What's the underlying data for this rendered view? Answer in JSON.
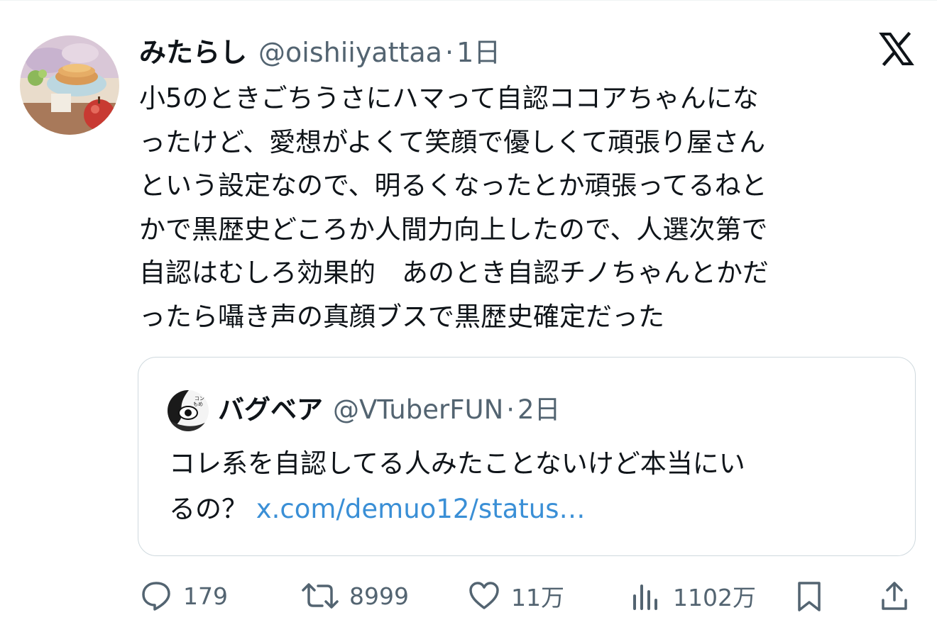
{
  "tweet": {
    "display_name": "みたらし",
    "handle": "@oishiiyattaa",
    "separator": "·",
    "time": "1日",
    "text_lines": [
      "小5のときごちうさにハマって自認ココアちゃんにな",
      "ったけど、愛想がよくて笑顔で優しくて頑張り屋さん",
      "という設定なので、明るくなったとか頑張ってるねと",
      "かで黒歴史どころか人間力向上したので、人選次第で",
      "自認はむしろ効果的　あのとき自認チノちゃんとかだ",
      "ったら囁き声の真顔ブスで黒歴史確定だった"
    ]
  },
  "quote": {
    "display_name": "バグベア",
    "handle": "@VTuberFUN",
    "separator": "·",
    "time": "2日",
    "text_line1": "コレ系を自認してる人みたことないけど本当にい",
    "text_line2_prefix": "るの？ ",
    "link": "x.com/demuo12/status…"
  },
  "actions": {
    "replies": "179",
    "reposts": "8999",
    "likes": "11万",
    "views": "1102万"
  },
  "icons": {
    "brand": "x-logo-icon",
    "reply": "reply-icon",
    "repost": "repost-icon",
    "like": "heart-icon",
    "views": "views-icon",
    "bookmark": "bookmark-icon",
    "share": "share-icon"
  },
  "colors": {
    "text": "#0f1419",
    "secondary": "#536471",
    "link": "#3a8fd6",
    "border": "#cfd9de"
  }
}
